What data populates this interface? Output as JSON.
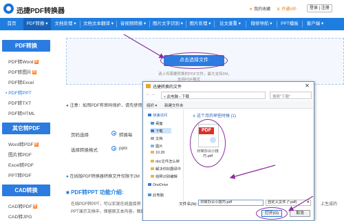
{
  "header": {
    "site_name": "迅捷PDF转换器",
    "favorites": "我的收藏",
    "vip": "开通VIP",
    "login": "登录",
    "register": "注册"
  },
  "nav": {
    "items": [
      {
        "label": "首页"
      },
      {
        "label": "PDF转换 ▾"
      },
      {
        "label": "文档处理 ▾"
      },
      {
        "label": "文档文本翻译 ▾"
      },
      {
        "label": "音视频转换 ▾"
      },
      {
        "label": "图片文字识别 ▾"
      },
      {
        "label": "图片处理 ▾"
      },
      {
        "label": "论文查重 ▾"
      },
      {
        "label": "微修导航 ▾"
      },
      {
        "label": "PPT模板"
      },
      {
        "label": "客户端 ▾"
      }
    ]
  },
  "sidebar": {
    "section1": "PDF转换",
    "items1": [
      {
        "label": "PDF转Word",
        "badge": true
      },
      {
        "label": "PDF转图片",
        "badge": true
      },
      {
        "label": "PDF转Excel",
        "badge": false
      },
      {
        "label": "• PDF转PPT",
        "badge": false,
        "selected": true
      },
      {
        "label": "PDF转TXT",
        "badge": false
      },
      {
        "label": "PDF转HTML",
        "badge": false
      }
    ],
    "section2": "其它转PDF",
    "items2": [
      {
        "label": "Word转PDF",
        "badge": true
      },
      {
        "label": "图片转PDF",
        "badge": false
      },
      {
        "label": "Excel转PDF",
        "badge": false
      },
      {
        "label": "PPT转PDF",
        "badge": false
      }
    ],
    "section3": "CAD转换",
    "items3": [
      {
        "label": "CAD转PDF",
        "badge": true
      },
      {
        "label": "CAD转JPG",
        "badge": false
      }
    ]
  },
  "main": {
    "upload_button": "点击选择文件",
    "upload_hint_1": "请上传需要转换的PDF文件，最大支持2M，",
    "upload_hint_2": "支持PDF格式",
    "note": "注意：如用PDF有密码保护，请先使用",
    "page_select_label": "页码选择",
    "page_select_value": "转换每",
    "format_label": "选择转换格式",
    "format_value": "pptx",
    "online_note": "在线版PDF转换器转换文件仅限于2M",
    "section_title": "PDF转PPT 功能介绍:",
    "para_1": "在线PDF转PPT，可以实现在线直接将",
    "para_1_right": "上生成的",
    "para_2": "PPT演示文档中，保留原文本内容，图固"
  },
  "dialog": {
    "title": "迅捷转换的文件",
    "close": "✕",
    "address": "« 此电脑 › 下载",
    "search_placeholder": "搜索\"下载\"",
    "organize": "组织 ▾",
    "new_folder": "新建文件夹",
    "tree": [
      {
        "label": "快速访问"
      },
      {
        "label": "桌面"
      },
      {
        "label": "下载"
      },
      {
        "label": "文档"
      },
      {
        "label": "图片"
      },
      {
        "label": "10.28"
      },
      {
        "label": "doc文件怎么转"
      },
      {
        "label": "解决你好翻译中"
      },
      {
        "label": "拍照识别编辑"
      },
      {
        "label": "OneDrive"
      },
      {
        "label": "此电脑"
      }
    ],
    "group_title": "∨ 这个月的早些时候 (1)",
    "pdf_badge": "PDF",
    "file_name": "日常办公小技巧.pdf",
    "filename_label": "文件名(N):",
    "filename_value": "日常办公小技巧.pdf",
    "filetype_value": "自定义文件 (*.pdf)",
    "open_button": "打开(O)",
    "cancel_button": "取消"
  }
}
